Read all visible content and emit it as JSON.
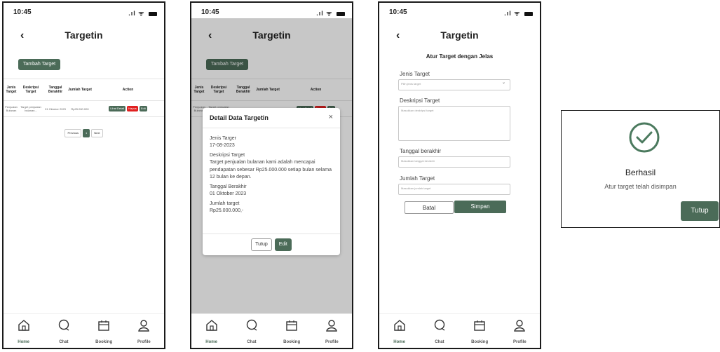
{
  "status_time": "10:45",
  "app_title": "Targetin",
  "add_button": "Tambah Target",
  "table": {
    "headers": [
      "Jenis Target",
      "Deskripsi Target",
      "Tanggal Berakhir",
      "Jumlah Target",
      "Action"
    ],
    "row": {
      "jenis": "Penjualan Bulanan",
      "deskripsi": "Target penjualan bulanan...",
      "tanggal": "01 Oktober 2023",
      "jumlah": "Rp25.000.000",
      "detail": "Lihat Detail",
      "hapus": "Hapus",
      "edit": "Edit"
    }
  },
  "pager": {
    "prev": "Previous",
    "page": "1",
    "next": "Next"
  },
  "nav": [
    "Home",
    "Chat",
    "Booking",
    "Profile"
  ],
  "modal": {
    "title": "Detail Data Targetin",
    "close": "×",
    "jenis_label": "Jenis Targer",
    "jenis_value": "17-08-2023",
    "desc_label": "Deskripsi Target",
    "desc_value": "Target penjualan bulanan kami adalah mencapai pendapatan sebesar Rp25.000.000 setiap bulan selama 12 bulan ke depan.",
    "date_label": "Tanggal Berakhir",
    "date_value": "01 Oktober 2023",
    "amount_label": "Jumlah target",
    "amount_value": "Rp25.000.000,-",
    "tutup": "Tutup",
    "edit": "Edit"
  },
  "form": {
    "title": "Atur Target dengan Jelas",
    "jenis_label": "Jenis Target",
    "jenis_placeholder": "Pilih jenis target",
    "desc_label": "Deskripsi Target",
    "desc_placeholder": "Masukkan deskripsi target",
    "date_label": "Tanggal berakhir",
    "date_placeholder": "Masukkan tanggal berakhir",
    "amount_label": "Jumlah Target",
    "amount_placeholder": "Masukkan jumlah target",
    "batal": "Batal",
    "simpan": "Simpan"
  },
  "success": {
    "title": "Berhasil",
    "desc": "Atur target telah disimpan",
    "button": "Tutup"
  },
  "colors": {
    "accent": "#4b6b58",
    "danger": "#e02020"
  },
  "icons": [
    "back-arrow-icon",
    "signal-icon",
    "wifi-icon",
    "battery-icon",
    "home-icon",
    "chat-icon",
    "calendar-icon",
    "profile-icon",
    "close-icon",
    "chevron-down-icon",
    "check-circle-icon"
  ]
}
